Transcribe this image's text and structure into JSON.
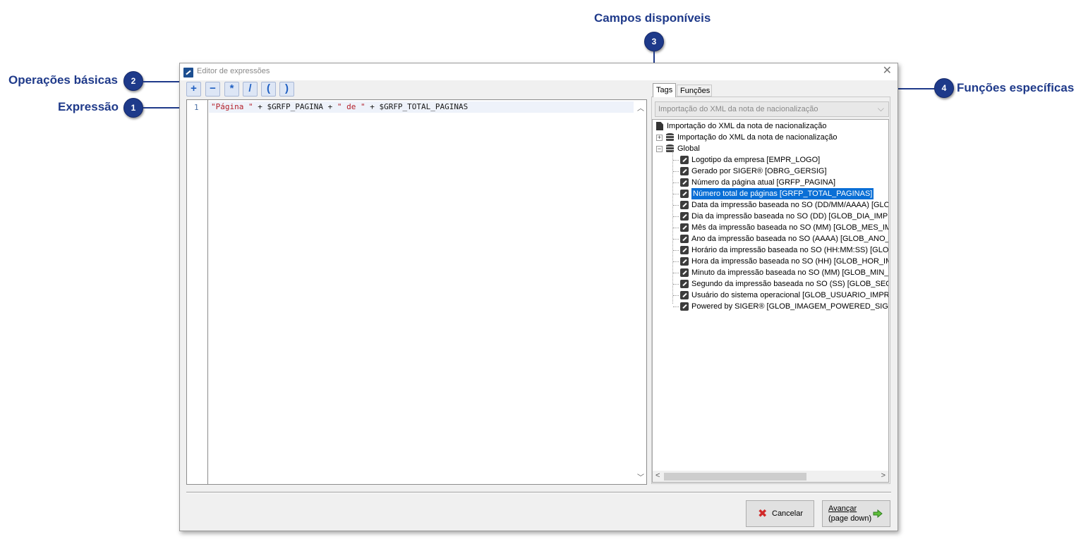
{
  "callouts": {
    "operacoes": {
      "label": "Operações básicas",
      "number": "2"
    },
    "expressao": {
      "label": "Expressão",
      "number": "1"
    },
    "campos": {
      "label": "Campos disponíveis",
      "number": "3"
    },
    "funcoes": {
      "label": "Funções específicas",
      "number": "4"
    }
  },
  "window": {
    "title": "Editor de expressões",
    "close": "✕"
  },
  "toolbar": {
    "buttons": [
      "+",
      "−",
      "*",
      "/",
      "(",
      ")"
    ]
  },
  "editor": {
    "line_number": "1",
    "tokens": [
      "\"Página \"",
      " + $GRFP_PAGINA + ",
      "\" de \"",
      " + $GRFP_TOTAL_PAGINAS"
    ]
  },
  "right_panel": {
    "tabs": [
      "Tags",
      "Funções"
    ],
    "combo_value": "Importação do XML da nota de nacionalização",
    "tree": {
      "root": "Importação do XML da nota de nacionalização",
      "group1": "Importação do XML da nota de nacionalização",
      "group2": "Global",
      "items": [
        "Logotipo da empresa [EMPR_LOGO]",
        "Gerado por SIGER® [OBRG_GERSIG]",
        "Número da página atual [GRFP_PAGINA]",
        "Número total de páginas [GRFP_TOTAL_PAGINAS]",
        "Data da impressão baseada no SO (DD/MM/AAAA) [GLOB_",
        "Dia da impressão baseada no SO (DD) [GLOB_DIA_IMPRE",
        "Mês da impressão baseada no SO (MM) [GLOB_MES_IMPR",
        "Ano da impressão baseada no SO (AAAA) [GLOB_ANO_IM",
        "Horário da impressão baseada no SO (HH:MM:SS) [GLOB_",
        "Hora da impressão baseada no SO (HH) [GLOB_HOR_IMPI",
        "Minuto da impressão baseada no SO (MM) [GLOB_MIN_IM",
        "Segundo da impressão baseada no SO (SS) [GLOB_SEG_I",
        "Usuário do sistema operacional [GLOB_USUARIO_IMPRES",
        "Powered by SIGER® [GLOB_IMAGEM_POWERED_SIGER]"
      ],
      "selected_index": 3
    }
  },
  "footer": {
    "cancel_label": "Cancelar",
    "next_line1": "Avançar",
    "next_line2": "(page down)"
  },
  "colors": {
    "callout": "#1f3a8a",
    "selection": "#0a6fd6",
    "string": "#b3202a"
  }
}
